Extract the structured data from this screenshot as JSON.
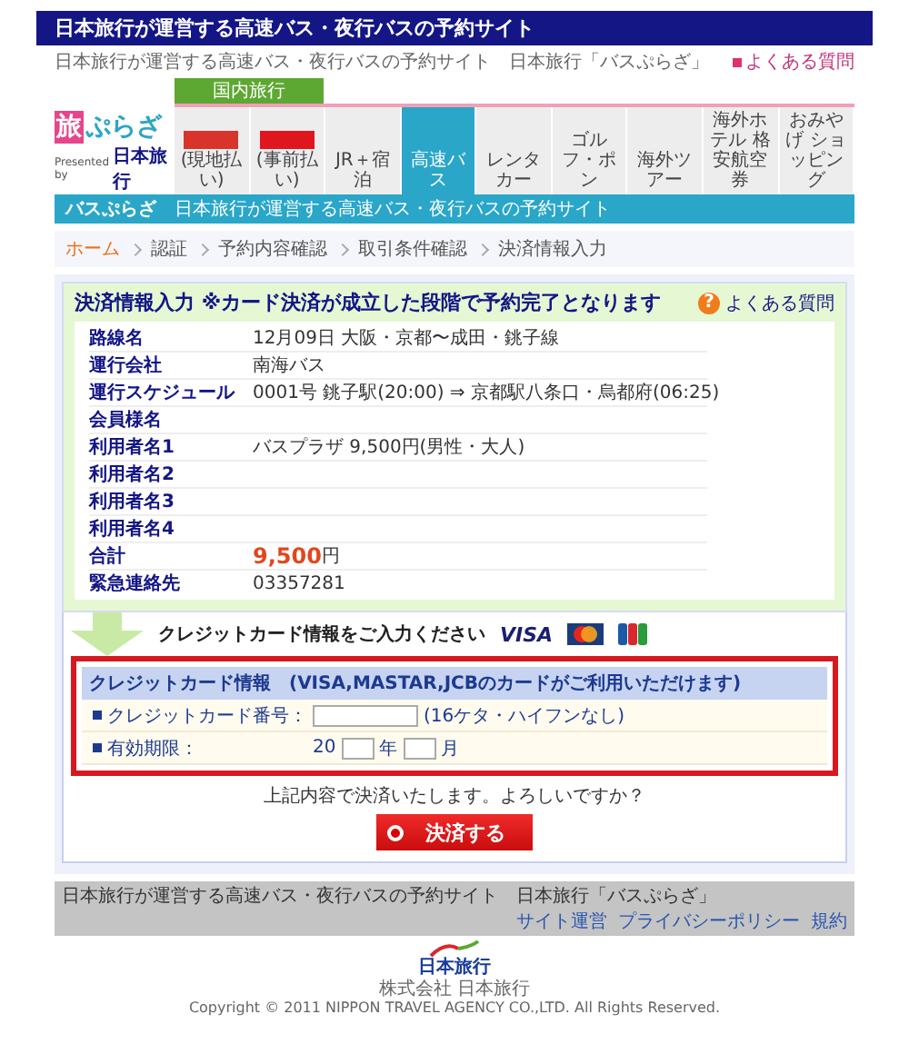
{
  "banner": {
    "title": "日本旅行が運営する高速バス・夜行バスの予約サイト"
  },
  "subheader": {
    "tagline": "日本旅行が運営する高速バス・夜行バスの予約サイト　日本旅行「バスぷらざ」",
    "help_link": "よくある質問"
  },
  "logo": {
    "mark": "旅",
    "name": "ぷらざ",
    "presented_by": "Presented by",
    "brand": "日本旅行"
  },
  "nav": {
    "group_label": "国内旅行",
    "items": [
      {
        "label": "(現地払い)",
        "kind": "promo",
        "color": "#d9342b",
        "selected": false
      },
      {
        "label": "(事前払い)",
        "kind": "promo",
        "color": "#e0161e",
        "selected": false
      },
      {
        "label": "JR＋宿泊",
        "kind": "plain",
        "selected": false
      },
      {
        "label": "高速バス",
        "kind": "plain",
        "selected": true
      },
      {
        "label": "レンタカー",
        "kind": "plain",
        "selected": false
      },
      {
        "label": "ゴルフ・ポン",
        "kind": "plain",
        "selected": false
      },
      {
        "label": "海外ツアー",
        "kind": "plain",
        "selected": false
      },
      {
        "label": "海外ホテル 格安航空券",
        "kind": "plain",
        "selected": false
      },
      {
        "label": "おみやげ ショッピング",
        "kind": "plain",
        "selected": false
      }
    ]
  },
  "section_bar": {
    "title": "バスぷらざ",
    "description": "日本旅行が運営する高速バス・夜行バスの予約サイト"
  },
  "breadcrumb": [
    {
      "label": "ホーム",
      "kind": "link"
    },
    {
      "label": "認証",
      "kind": "step"
    },
    {
      "label": "予約内容確認",
      "kind": "step"
    },
    {
      "label": "取引条件確認",
      "kind": "step"
    },
    {
      "label": "決済情報入力",
      "kind": "step"
    }
  ],
  "booking": {
    "title": "決済情報入力 ※カード決済が成立した段階で予約完了となります",
    "help_icon": "?",
    "help_link": "よくある質問",
    "rows": [
      {
        "label": "路線名",
        "value": "12月09日 大阪・京都〜成田・銚子線",
        "kind": "text"
      },
      {
        "label": "運行会社",
        "value": "南海バス",
        "kind": "text"
      },
      {
        "label": "運行スケジュール",
        "value": "0001号 銚子駅(20:00) ⇒ 京都駅八条口・烏都府(06:25)",
        "kind": "text"
      },
      {
        "label": "会員様名",
        "kind": "text"
      },
      {
        "label": "利用者名1",
        "value": "バスプラザ 9,500円(男性・大人)",
        "kind": "text"
      },
      {
        "label": "利用者名2",
        "kind": "text"
      },
      {
        "label": "利用者名3",
        "kind": "text"
      },
      {
        "label": "利用者名4",
        "kind": "text"
      },
      {
        "label": "合計",
        "value": "9,500",
        "unit": "円",
        "kind": "total"
      },
      {
        "label": "緊急連絡先",
        "value": "03357281",
        "kind": "text"
      }
    ]
  },
  "payment": {
    "prompt": "クレジットカード情報をご入力ください",
    "visa": "VISA",
    "card_box": {
      "title": "クレジットカード情報　(VISA,MASTAR,JCBのカードがご利用いただけます)",
      "number_label": "クレジットカード番号：",
      "number_hint": "(16ケタ・ハイフンなし)",
      "expiry_label": "有効期限：",
      "year_prefix": "20",
      "year_unit": "年",
      "month_unit": "月"
    },
    "confirm_text": "上記内容で決済いたします。よろしいですか？",
    "submit": "決済する"
  },
  "footer": {
    "tagline": "日本旅行が運営する高速バス・夜行バスの予約サイト　日本旅行「バスぷらざ」",
    "links": [
      "サイト運営",
      "プライバシーポリシー",
      "規約"
    ],
    "logo_text": "日本旅行",
    "company": "株式会社 日本旅行",
    "copyright": "Copyright © 2011 NIPPON TRAVEL AGENCY CO.,LTD. All Rights Reserved."
  }
}
